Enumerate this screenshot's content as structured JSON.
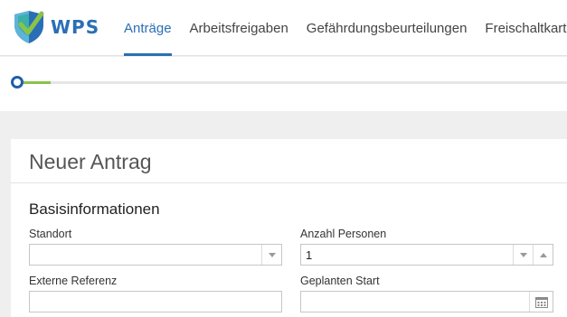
{
  "brand": {
    "name": "WPS",
    "primary_color": "#2a6fb5",
    "accent_green": "#8bc34a",
    "logo_icon": "shield-check-icon"
  },
  "nav": {
    "tabs": [
      {
        "label": "Anträge",
        "active": true
      },
      {
        "label": "Arbeitsfreigaben",
        "active": false
      },
      {
        "label": "Gefährdungsbeurteilungen",
        "active": false
      },
      {
        "label": "Freischaltkart",
        "active": false
      }
    ]
  },
  "stepper": {
    "current_step": 1
  },
  "form": {
    "title": "Neuer Antrag",
    "section_title": "Basisinformationen",
    "fields": {
      "standort": {
        "label": "Standort",
        "value": "",
        "type": "select"
      },
      "anzahl_personen": {
        "label": "Anzahl Personen",
        "value": "1",
        "type": "number-select"
      },
      "externe_referenz": {
        "label": "Externe Referenz",
        "value": "",
        "type": "text"
      },
      "geplanter_start": {
        "label": "Geplanten Start",
        "value": "",
        "type": "date"
      }
    }
  }
}
